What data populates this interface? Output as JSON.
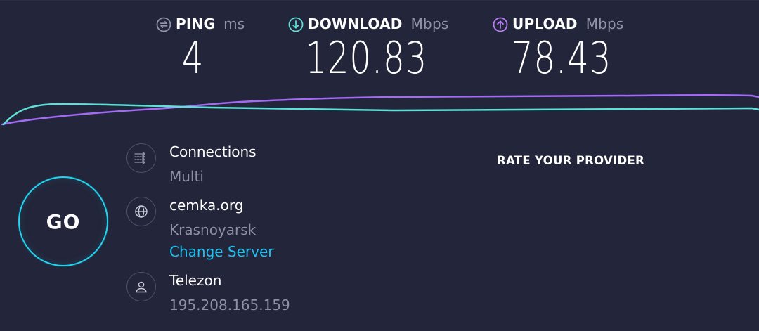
{
  "metrics": {
    "ping": {
      "label": "PING",
      "unit": "ms",
      "value": "4",
      "icon": "ping-icon",
      "color": "#9193a8"
    },
    "download": {
      "label": "DOWNLOAD",
      "unit": "Mbps",
      "value": "120.83",
      "icon": "download-arrow-icon",
      "color": "#5ee0d8"
    },
    "upload": {
      "label": "UPLOAD",
      "unit": "Mbps",
      "value": "78.43",
      "icon": "upload-arrow-icon",
      "color": "#b87ef5"
    }
  },
  "go_button": {
    "label": "GO",
    "color": "#1fd5f0"
  },
  "connections": {
    "title": "Connections",
    "value": "Multi",
    "icon": "connections-icon"
  },
  "server": {
    "host": "cemka.org",
    "city": "Krasnoyarsk",
    "change_link": "Change Server",
    "icon": "globe-icon"
  },
  "isp": {
    "name": "Telezon",
    "ip": "195.208.165.159",
    "icon": "user-icon"
  },
  "rate_provider": {
    "label": "RATE YOUR PROVIDER"
  },
  "colors": {
    "background": "#23253a",
    "accent": "#1fd5f0",
    "link": "#1fbff0",
    "download_line": "#5ee0d8",
    "upload_line": "#a36af2"
  }
}
